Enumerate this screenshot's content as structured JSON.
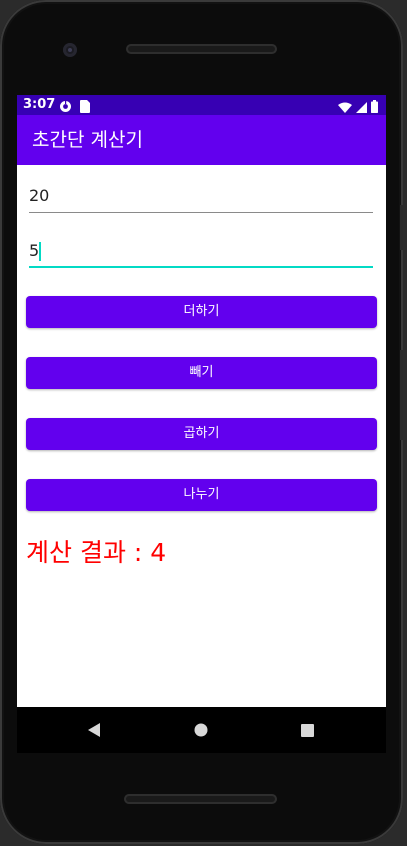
{
  "status_bar": {
    "time": "3:07",
    "icons": [
      "data-saver-icon",
      "sim-card-icon",
      "wifi-icon",
      "signal-icon",
      "battery-icon"
    ]
  },
  "app_bar": {
    "title": "초간단 계산기"
  },
  "inputs": {
    "first": {
      "value": "20"
    },
    "second": {
      "value": "5"
    }
  },
  "buttons": {
    "add": "더하기",
    "subtract": "빼기",
    "multiply": "곱하기",
    "divide": "나누기"
  },
  "result": {
    "text": "계산 결과 : 4"
  },
  "navigation": {
    "icons": [
      "back-icon",
      "home-icon",
      "recents-icon"
    ]
  },
  "colors": {
    "status_bar": "#3700b3",
    "primary": "#6200ee",
    "accent": "#03dac5",
    "result_text": "#ff0000"
  }
}
